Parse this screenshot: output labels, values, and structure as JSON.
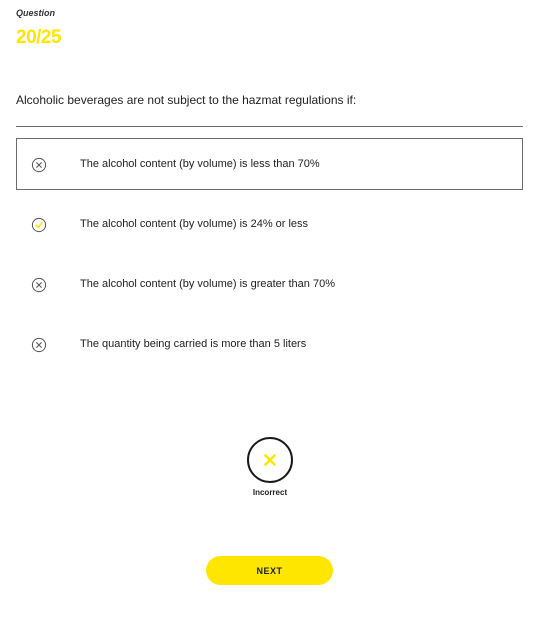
{
  "question": {
    "label": "Question",
    "counter": "20/25",
    "text": "Alcoholic beverages are not subject to the hazmat regulations if:"
  },
  "options": [
    {
      "label": "The alcohol content (by volume) is less than 70%",
      "icon": "x-circle-icon",
      "selected": true
    },
    {
      "label": "The alcohol content (by volume) is 24% or less",
      "icon": "check-circle-icon",
      "selected": false
    },
    {
      "label": "The alcohol content (by volume) is greater than 70%",
      "icon": "x-circle-icon",
      "selected": false
    },
    {
      "label": "The quantity being carried is more than 5 liters",
      "icon": "x-circle-icon",
      "selected": false
    }
  ],
  "result": {
    "label": "Incorrect",
    "icon": "x-icon"
  },
  "next_button": {
    "label": "NEXT"
  },
  "colors": {
    "accent": "#ffe600",
    "text": "#222222",
    "border": "#6b6b6b"
  }
}
